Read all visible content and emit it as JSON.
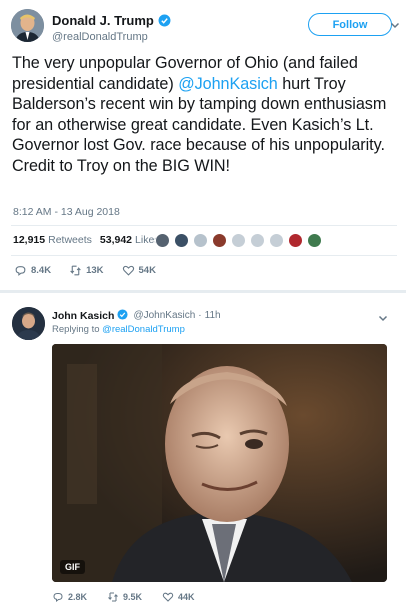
{
  "tweet": {
    "author": {
      "display_name": "Donald J. Trump",
      "handle": "@realDonaldTrump",
      "verified": true
    },
    "follow_label": "Follow",
    "text_before": "The very unpopular Governor of Ohio (and failed presidential candidate) ",
    "mention": "@JohnKasich",
    "text_after": " hurt Troy Balderson’s recent win by tamping down enthusiasm for an otherwise great candidate. Even Kasich’s Lt. Governor lost Gov. race because of his unpopularity. Credit to Troy on the BIG WIN!",
    "timestamp": "8:12 AM - 13 Aug 2018",
    "stats": {
      "retweets_count": "12,915",
      "retweets_label": "Retweets",
      "likes_count": "53,942",
      "likes_label": "Likes"
    },
    "actions": {
      "replies": "8.4K",
      "retweets": "13K",
      "likes": "54K"
    }
  },
  "reply": {
    "author": {
      "display_name": "John Kasich",
      "handle": "@JohnKasich",
      "verified": true
    },
    "separator": "·",
    "time": "11h",
    "replying_prefix": "Replying to",
    "replying_to": "@realDonaldTrump",
    "media_badge": "GIF",
    "actions": {
      "replies": "2.8K",
      "retweets": "9.5K",
      "likes": "44K"
    }
  },
  "colors": {
    "brand": "#1da1f2",
    "text": "#14171a",
    "muted": "#657786",
    "border": "#e6ecf0"
  },
  "icons": [
    "verified-badge-icon",
    "chevron-down-icon",
    "reply-icon",
    "retweet-icon",
    "like-icon"
  ]
}
